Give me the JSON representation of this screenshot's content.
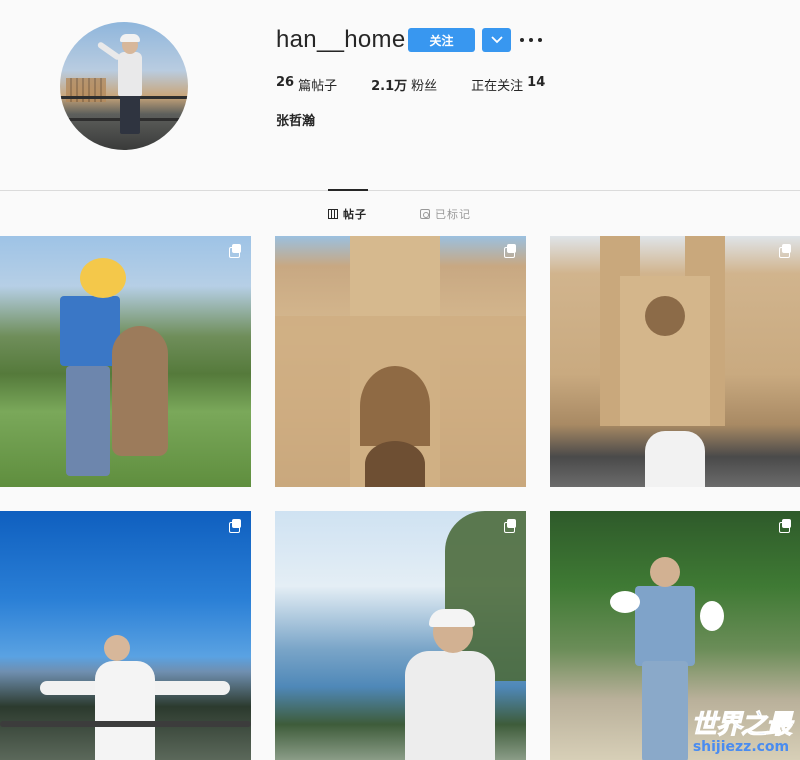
{
  "profile": {
    "username": "han__home",
    "follow_label": "关注",
    "stats": {
      "posts_count": "26",
      "posts_label": "篇帖子",
      "followers_count": "2.1万",
      "followers_label": "粉丝",
      "following_label": "正在关注",
      "following_count": "14"
    },
    "full_name": "张哲瀚"
  },
  "tabs": {
    "posts_label": "帖子",
    "tagged_label": "已标记"
  },
  "posts": [
    {
      "scene": "kangaroo-park",
      "multi": true
    },
    {
      "scene": "gothic-building",
      "multi": true
    },
    {
      "scene": "cathedral",
      "multi": true
    },
    {
      "scene": "blue-mountains",
      "multi": true
    },
    {
      "scene": "coastal-view",
      "multi": true
    },
    {
      "scene": "park-cockatoos",
      "multi": true
    }
  ],
  "watermark": {
    "main": "世界之最",
    "sub": "shijiezz.com"
  },
  "colors": {
    "accent": "#3897f0",
    "text": "#262626",
    "muted": "#999999",
    "background": "#fafafa",
    "watermark": "#4a8cf0"
  },
  "icons": [
    "avatar-photo",
    "chevron-down-icon",
    "more-options-icon",
    "grid-icon",
    "tagged-icon",
    "multiple-photos-icon"
  ]
}
